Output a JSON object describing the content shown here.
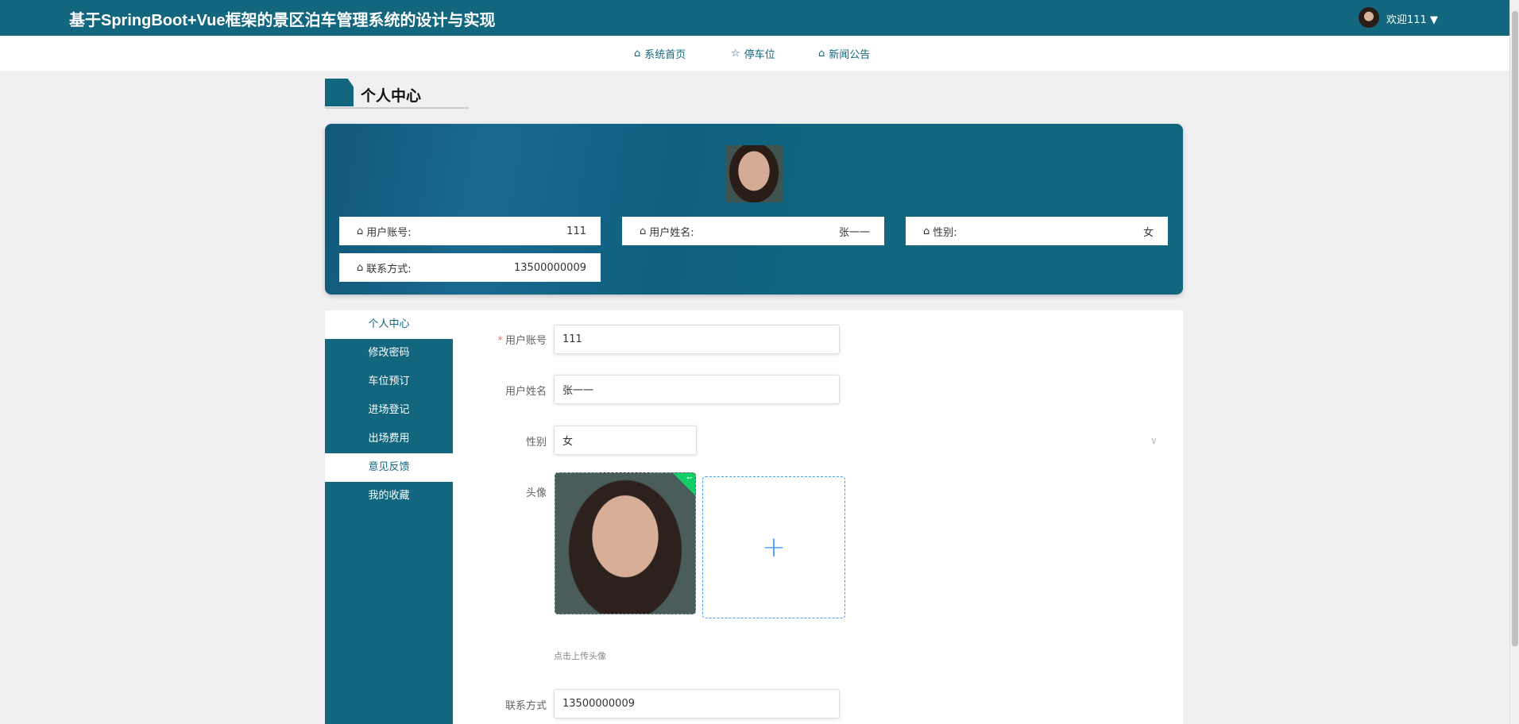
{
  "header": {
    "title": "基于SpringBoot+Vue框架的景区泊车管理系统的设计与实现",
    "welcome": "欢迎111 ▼"
  },
  "nav": [
    {
      "label": "系统首页",
      "icon": "home-icon"
    },
    {
      "label": "停车位",
      "icon": "star-icon"
    },
    {
      "label": "新闻公告",
      "icon": "bag-icon"
    }
  ],
  "page_title": "个人中心",
  "profile": {
    "account": {
      "label": "用户账号:",
      "value": "111"
    },
    "name": {
      "label": "用户姓名:",
      "value": "张一一"
    },
    "gender": {
      "label": "性别:",
      "value": "女"
    },
    "phone": {
      "label": "联系方式:",
      "value": "13500000009"
    }
  },
  "sidebar": [
    {
      "label": "个人中心"
    },
    {
      "label": "修改密码"
    },
    {
      "label": "车位预订"
    },
    {
      "label": "进场登记"
    },
    {
      "label": "出场费用"
    },
    {
      "label": "意见反馈"
    },
    {
      "label": "我的收藏"
    }
  ],
  "form": {
    "account": {
      "label": "用户账号",
      "value": "111"
    },
    "name": {
      "label": "用户姓名",
      "value": "张一一"
    },
    "gender": {
      "label": "性别",
      "value": "女"
    },
    "avatar": {
      "label": "头像",
      "hint": "点击上传头像"
    },
    "phone": {
      "label": "联系方式",
      "value": "13500000009"
    }
  },
  "colors": {
    "primary": "#12677f",
    "upload": "#409eff",
    "success": "#13ce66"
  }
}
